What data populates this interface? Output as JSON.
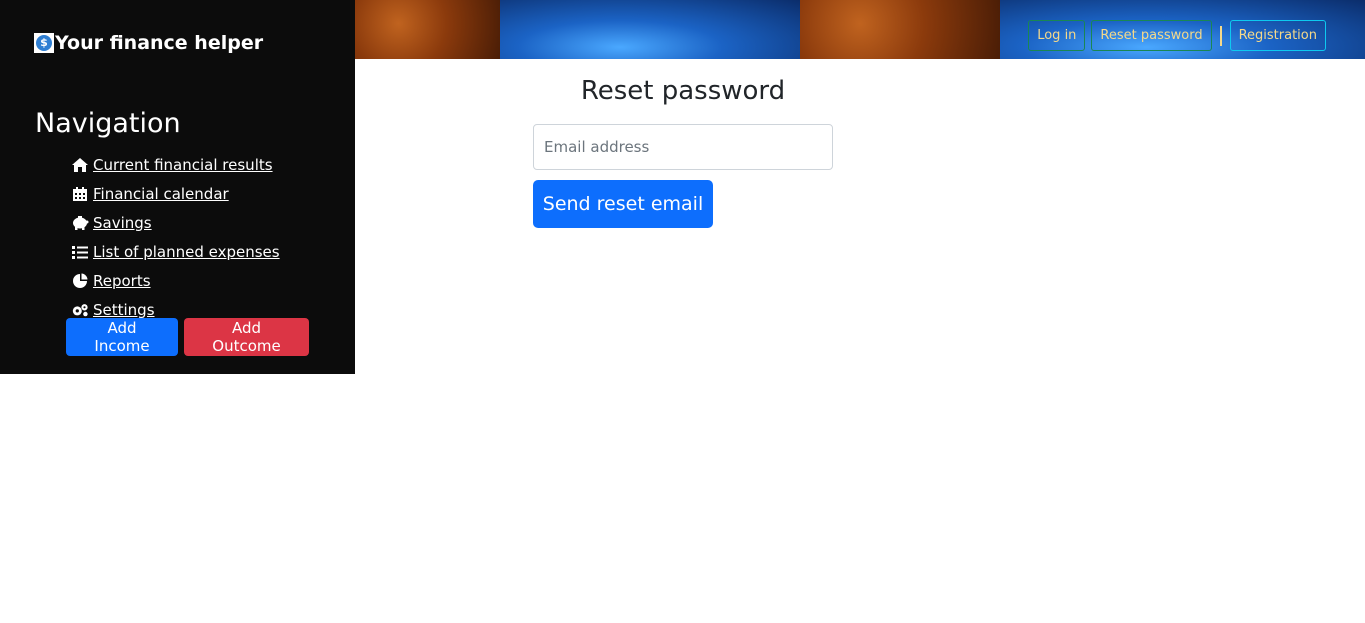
{
  "brand": {
    "name": "Your finance helper",
    "logo_icon": "dollar-coin-icon"
  },
  "nav": {
    "title": "Navigation",
    "items": [
      {
        "label": "Current financial results",
        "icon": "home-icon"
      },
      {
        "label": "Financial calendar",
        "icon": "calendar-icon"
      },
      {
        "label": "Savings",
        "icon": "piggy-bank-icon"
      },
      {
        "label": "List of planned expenses",
        "icon": "list-icon"
      },
      {
        "label": "Reports",
        "icon": "pie-chart-icon"
      },
      {
        "label": "Settings",
        "icon": "gears-icon"
      }
    ]
  },
  "actions": {
    "add_income": "Add Income",
    "add_outcome": "Add Outcome"
  },
  "header": {
    "login": "Log in",
    "reset_password": "Reset password",
    "registration": "Registration"
  },
  "main": {
    "title": "Reset password",
    "email_placeholder": "Email address",
    "submit": "Send reset email"
  },
  "colors": {
    "sidebar_bg": "#0c0c0c",
    "primary": "#0d6efd",
    "danger": "#dc3545",
    "header_text": "#f5d98a"
  }
}
